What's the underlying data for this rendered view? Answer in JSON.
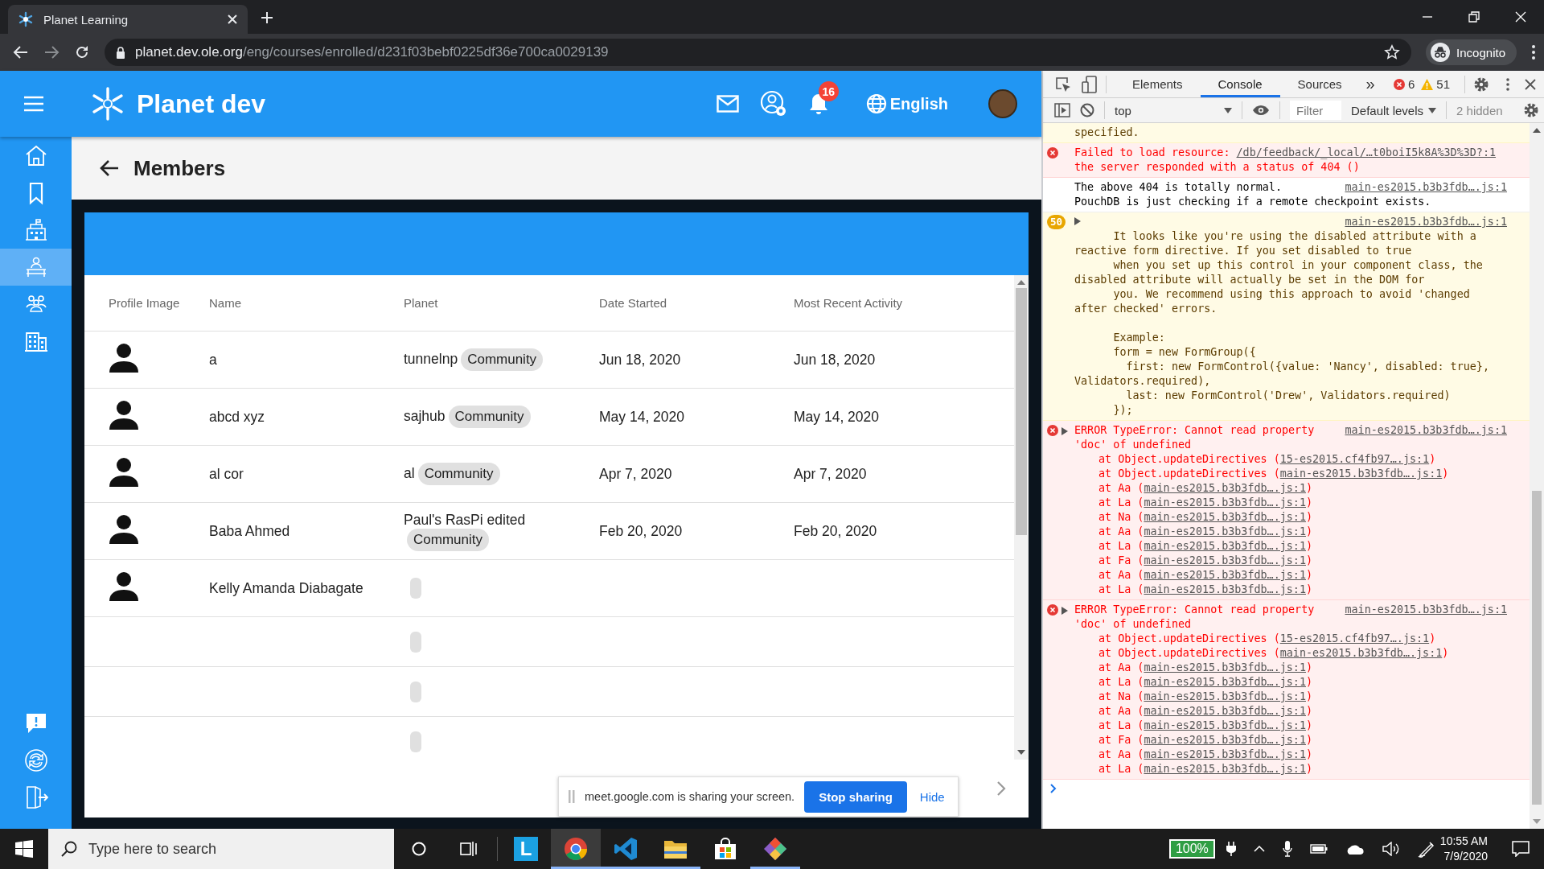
{
  "browser": {
    "tab_title": "Planet Learning",
    "url_host": "planet.dev.ole.org",
    "url_path": "/eng/courses/enrolled/d231f03bebf0225df36e700ca0029139",
    "profile_label": "Incognito"
  },
  "app": {
    "brand": "Planet dev",
    "notification_count": "16",
    "language": "English",
    "sidebar": [
      {
        "kind": "home",
        "selected": false
      },
      {
        "kind": "bookmark",
        "selected": false
      },
      {
        "kind": "school",
        "selected": false
      },
      {
        "kind": "course",
        "selected": true
      },
      {
        "kind": "team",
        "selected": false
      },
      {
        "kind": "office",
        "selected": false
      }
    ],
    "sidebar_bottom": [
      {
        "kind": "feedback"
      },
      {
        "kind": "sync"
      },
      {
        "kind": "logout"
      }
    ],
    "page_title": "Members",
    "table": {
      "columns": [
        "Profile Image",
        "Name",
        "Planet",
        "Date Started",
        "Most Recent Activity"
      ],
      "rows": [
        {
          "kind": "member",
          "name": "a",
          "planet": "tunnelnp",
          "planet_tag": "Community",
          "date_started": "Jun 18, 2020",
          "recent_activity": "Jun 18, 2020"
        },
        {
          "kind": "member",
          "name": "abcd xyz",
          "planet": "sajhub",
          "planet_tag": "Community",
          "date_started": "May 14, 2020",
          "recent_activity": "May 14, 2020"
        },
        {
          "kind": "member",
          "name": "al cor",
          "planet": "al",
          "planet_tag": "Community",
          "date_started": "Apr 7, 2020",
          "recent_activity": "Apr 7, 2020"
        },
        {
          "kind": "member",
          "name": "Baba Ahmed",
          "planet": "Paul's RasPi edited",
          "planet_tag": "Community",
          "date_started": "Feb 20, 2020",
          "recent_activity": "Feb 20, 2020"
        },
        {
          "kind": "member",
          "name": "Kelly Amanda Diabagate"
        },
        {
          "kind": "empty"
        },
        {
          "kind": "empty"
        },
        {
          "kind": "empty"
        }
      ]
    },
    "share_bar": {
      "message": "meet.google.com is sharing your screen.",
      "stop_button": "Stop sharing",
      "hide_button": "Hide"
    }
  },
  "devtools": {
    "tabs": [
      {
        "label": "Elements",
        "selected": false
      },
      {
        "label": "Console",
        "selected": true
      },
      {
        "label": "Sources",
        "selected": false
      }
    ],
    "overflow": "»",
    "error_count": "6",
    "warning_count": "51",
    "context": "top",
    "filter_placeholder": "Filter",
    "levels": "Default levels",
    "hidden_count": "2 hidden",
    "messages": [
      {
        "kind": "continuation",
        "text": "specified."
      },
      {
        "kind": "resource_error",
        "text": "Failed to load resource:",
        "link": "/db/feedback/_local/…t0boiI5k8A%3D%3D?:1",
        "detail": "the server responded with a status of 404 ()"
      },
      {
        "kind": "info",
        "link": "main-es2015.b3b3fdb….js:1",
        "lines": [
          "The above 404 is totally normal.",
          "PouchDB is just checking if a remote checkpoint exists."
        ]
      },
      {
        "kind": "warning",
        "count": "50",
        "link": "main-es2015.b3b3fdb….js:1",
        "text": "      It looks like you're using the disabled attribute with a reactive form directive. If you set disabled to true\n      when you set up this control in your component class, the disabled attribute will actually be set in the DOM for\n      you. We recommend using this approach to avoid 'changed after checked' errors.\n\n      Example:\n      form = new FormGroup({\n        first: new FormControl({value: 'Nancy', disabled: true}, Validators.required),\n        last: new FormControl('Drew', Validators.required)\n      });"
      },
      {
        "kind": "error",
        "lines": [
          "ERROR TypeError: Cannot read property",
          "'doc' of undefined"
        ],
        "link": "main-es2015.b3b3fdb….js:1",
        "frames": [
          {
            "call": "at Object.updateDirectives (",
            "link": "15-es2015.cf4fb97….js:1",
            "after": ")"
          },
          {
            "call": "at Object.updateDirectives (",
            "link": "main-es2015.b3b3fdb….js:1",
            "after": ")"
          },
          {
            "call": "at Aa (",
            "link": "main-es2015.b3b3fdb….js:1",
            "after": ")"
          },
          {
            "call": "at La (",
            "link": "main-es2015.b3b3fdb….js:1",
            "after": ")"
          },
          {
            "call": "at Na (",
            "link": "main-es2015.b3b3fdb….js:1",
            "after": ")"
          },
          {
            "call": "at Aa (",
            "link": "main-es2015.b3b3fdb….js:1",
            "after": ")"
          },
          {
            "call": "at La (",
            "link": "main-es2015.b3b3fdb….js:1",
            "after": ")"
          },
          {
            "call": "at Fa (",
            "link": "main-es2015.b3b3fdb….js:1",
            "after": ")"
          },
          {
            "call": "at Aa (",
            "link": "main-es2015.b3b3fdb….js:1",
            "after": ")"
          },
          {
            "call": "at La (",
            "link": "main-es2015.b3b3fdb….js:1",
            "after": ")"
          }
        ]
      },
      {
        "kind": "error",
        "lines": [
          "ERROR TypeError: Cannot read property",
          "'doc' of undefined"
        ],
        "link": "main-es2015.b3b3fdb….js:1",
        "frames": [
          {
            "call": "at Object.updateDirectives (",
            "link": "15-es2015.cf4fb97….js:1",
            "after": ")"
          },
          {
            "call": "at Object.updateDirectives (",
            "link": "main-es2015.b3b3fdb….js:1",
            "after": ")"
          },
          {
            "call": "at Aa (",
            "link": "main-es2015.b3b3fdb….js:1",
            "after": ")"
          },
          {
            "call": "at La (",
            "link": "main-es2015.b3b3fdb….js:1",
            "after": ")"
          },
          {
            "call": "at Na (",
            "link": "main-es2015.b3b3fdb….js:1",
            "after": ")"
          },
          {
            "call": "at Aa (",
            "link": "main-es2015.b3b3fdb….js:1",
            "after": ")"
          },
          {
            "call": "at La (",
            "link": "main-es2015.b3b3fdb….js:1",
            "after": ")"
          },
          {
            "call": "at Fa (",
            "link": "main-es2015.b3b3fdb….js:1",
            "after": ")"
          },
          {
            "call": "at Aa (",
            "link": "main-es2015.b3b3fdb….js:1",
            "after": ")"
          },
          {
            "call": "at La (",
            "link": "main-es2015.b3b3fdb….js:1",
            "after": ")"
          }
        ]
      }
    ]
  },
  "taskbar": {
    "search_placeholder": "Type here to search",
    "apps": [
      {
        "kind": "letter",
        "label": "L",
        "running": false,
        "selected": false
      },
      {
        "kind": "browser",
        "running": true,
        "selected": true
      },
      {
        "kind": "editor",
        "running": true,
        "selected": false
      },
      {
        "kind": "folder",
        "running": true,
        "selected": false
      },
      {
        "kind": "store",
        "running": false,
        "selected": false
      },
      {
        "kind": "git",
        "running": true,
        "selected": false
      }
    ],
    "battery": "100%",
    "time": "10:55 AM",
    "date": "7/9/2020"
  }
}
